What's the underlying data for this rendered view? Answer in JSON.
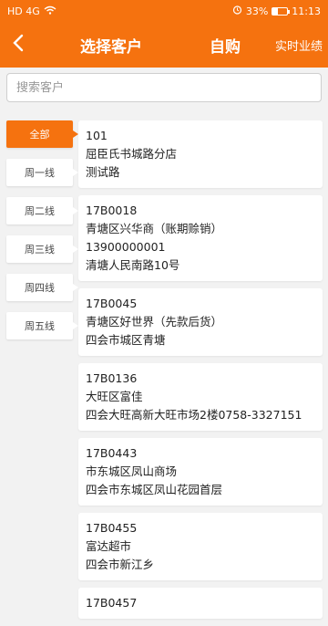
{
  "status_bar": {
    "left": "HD 4G",
    "battery": "33%",
    "battery_level": 0.33,
    "time": "11:13"
  },
  "header": {
    "back_icon": "chevron-left-icon",
    "title": "选择客户",
    "mode": "自购",
    "realtime": "实时业绩"
  },
  "search": {
    "placeholder": "搜索客户",
    "value": ""
  },
  "tabs": [
    {
      "label": "全部",
      "active": true
    },
    {
      "label": "周一线",
      "active": false
    },
    {
      "label": "周二线",
      "active": false
    },
    {
      "label": "周三线",
      "active": false
    },
    {
      "label": "周四线",
      "active": false
    },
    {
      "label": "周五线",
      "active": false
    }
  ],
  "customers": [
    {
      "lines": [
        "101",
        "屈臣氏书城路分店",
        "测试路"
      ]
    },
    {
      "lines": [
        "17B0018",
        "青塘区兴华商（账期赊销）",
        "13900000001",
        "清塘人民南路10号"
      ]
    },
    {
      "lines": [
        "17B0045",
        "青塘区好世界（先款后货）",
        "四会市城区青塘"
      ]
    },
    {
      "lines": [
        "17B0136",
        "大旺区富佳",
        "四会大旺高新大旺市场2楼0758-3327151"
      ]
    },
    {
      "lines": [
        "17B0443",
        "市东城区凤山商场",
        "四会市东城区凤山花园首层"
      ]
    },
    {
      "lines": [
        "17B0455",
        "富达超市",
        "四会市新江乡"
      ]
    },
    {
      "lines": [
        "17B0457"
      ]
    }
  ],
  "colors": {
    "accent": "#f5720f",
    "background": "#f2f2f2"
  }
}
